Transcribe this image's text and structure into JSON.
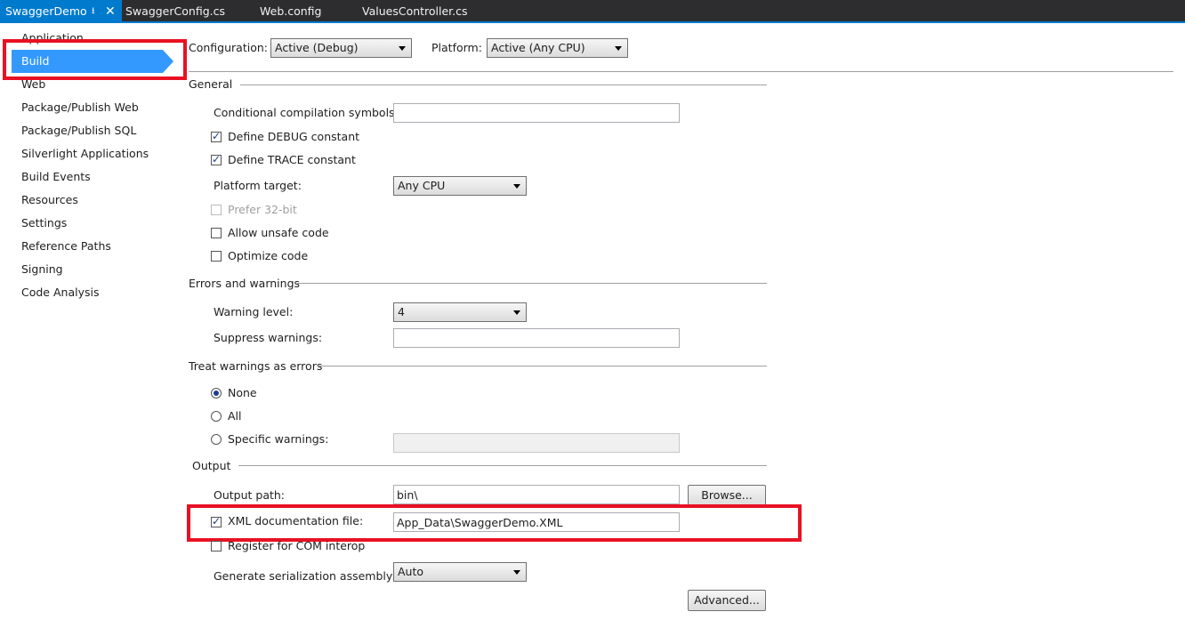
{
  "tabs": [
    {
      "label": "SwaggerDemo",
      "active": true,
      "pin": "pin-icon",
      "close": "close-icon"
    },
    {
      "label": "SwaggerConfig.cs",
      "active": false
    },
    {
      "label": "Web.config",
      "active": false
    },
    {
      "label": "ValuesController.cs",
      "active": false
    }
  ],
  "sidebar": {
    "items": [
      "Application",
      "Build",
      "Web",
      "Package/Publish Web",
      "Package/Publish SQL",
      "Silverlight Applications",
      "Build Events",
      "Resources",
      "Settings",
      "Reference Paths",
      "Signing",
      "Code Analysis"
    ],
    "selected": "Build"
  },
  "config": {
    "configuration_label": "Configuration:",
    "configuration_value": "Active (Debug)",
    "platform_label": "Platform:",
    "platform_value": "Active (Any CPU)"
  },
  "general": {
    "title": "General",
    "cond_symbols_label": "Conditional compilation symbols:",
    "cond_symbols_value": "",
    "define_debug": {
      "label": "Define DEBUG constant",
      "checked": true
    },
    "define_trace": {
      "label": "Define TRACE constant",
      "checked": true
    },
    "platform_target_label": "Platform target:",
    "platform_target_value": "Any CPU",
    "prefer32": {
      "label": "Prefer 32-bit",
      "checked": false,
      "disabled": true
    },
    "unsafe": {
      "label": "Allow unsafe code",
      "checked": false
    },
    "optimize": {
      "label": "Optimize code",
      "checked": false
    }
  },
  "errors": {
    "title": "Errors and warnings",
    "warning_level_label": "Warning level:",
    "warning_level_value": "4",
    "suppress_label": "Suppress warnings:",
    "suppress_value": ""
  },
  "treat": {
    "title": "Treat warnings as errors",
    "none": {
      "label": "None",
      "selected": true
    },
    "all": {
      "label": "All",
      "selected": false
    },
    "specific": {
      "label": "Specific warnings:",
      "selected": false
    },
    "specific_value": ""
  },
  "output": {
    "title": "Output",
    "path_label": "Output path:",
    "path_value": "bin\\",
    "browse_label": "Browse...",
    "xml_doc": {
      "label": "XML documentation file:",
      "checked": true
    },
    "xml_doc_value": "App_Data\\SwaggerDemo.XML",
    "com_interop": {
      "label": "Register for COM interop",
      "checked": false
    },
    "serialization_label": "Generate serialization assembly:",
    "serialization_value": "Auto",
    "advanced_label": "Advanced..."
  },
  "colors": {
    "accent": "#007acc",
    "selection": "#3399ff",
    "highlight": "#e81123"
  }
}
